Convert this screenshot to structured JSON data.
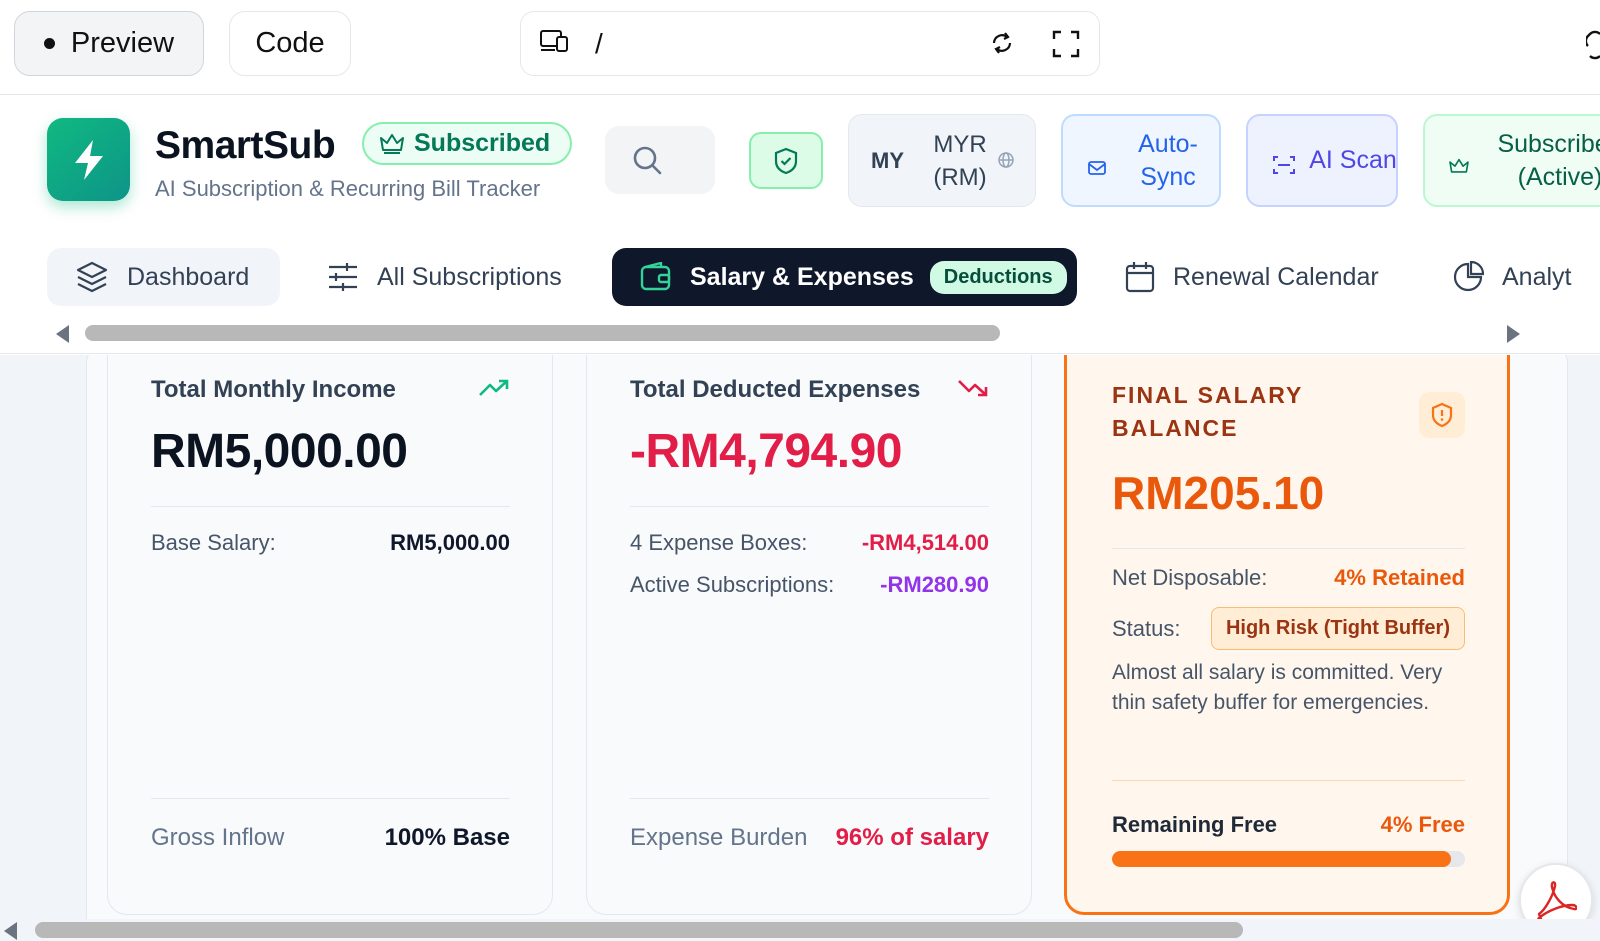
{
  "toolbar": {
    "preview_label": "Preview",
    "code_label": "Code",
    "url_path": "/"
  },
  "header": {
    "brand": "SmartSub",
    "subscribed_badge": "Subscribed",
    "tagline": "AI Subscription & Recurring Bill Tracker",
    "currency_code": "MY",
    "currency_label": "MYR (RM)",
    "auto_sync_label": "Auto-Sync",
    "ai_scan_label": "AI Scan",
    "subscribed_active_label": "Subscribed (Active)"
  },
  "nav": {
    "tabs": [
      {
        "label": "Dashboard",
        "icon": "layers-icon",
        "active": false
      },
      {
        "label": "All Subscriptions",
        "icon": "sliders-icon",
        "active": false
      },
      {
        "label": "Salary & Expenses",
        "icon": "wallet-icon",
        "active": true,
        "badge": "Deductions"
      },
      {
        "label": "Renewal Calendar",
        "icon": "calendar-icon",
        "active": false
      },
      {
        "label": "Analyt",
        "icon": "pie-chart-icon",
        "active": false
      }
    ]
  },
  "income_card": {
    "title": "Total Monthly Income",
    "amount": "RM5,000.00",
    "rows": [
      {
        "label": "Base Salary:",
        "value": "RM5,000.00"
      }
    ],
    "footer_label": "Gross Inflow",
    "footer_value": "100% Base"
  },
  "expense_card": {
    "title": "Total Deducted Expenses",
    "amount": "-RM4,794.90",
    "rows": [
      {
        "label": "4 Expense Boxes:",
        "value": "-RM4,514.00"
      },
      {
        "label": "Active Subscriptions:",
        "value": "-RM280.90"
      }
    ],
    "footer_label": "Expense Burden",
    "footer_value": "96% of salary"
  },
  "balance_card": {
    "title": "FINAL SALARY BALANCE",
    "amount": "RM205.10",
    "net_label": "Net Disposable:",
    "net_value": "4% Retained",
    "status_label": "Status:",
    "status_value": "High Risk (Tight Buffer)",
    "description": "Almost all salary is committed. Very thin safety buffer for emergencies.",
    "remaining_label": "Remaining Free",
    "remaining_value": "4% Free",
    "remaining_fraction": 0.96
  },
  "colors": {
    "accent_green": "#10b981",
    "expense_red": "#e11d48",
    "balance_orange": "#f97316",
    "nav_active_bg": "#0f172a"
  }
}
